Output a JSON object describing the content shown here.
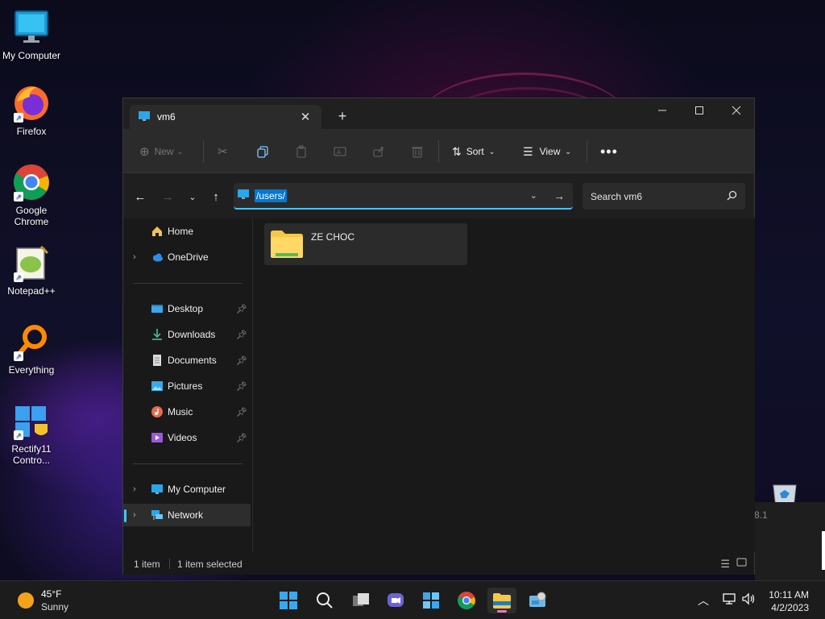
{
  "desktop": {
    "icons": [
      {
        "label": "My Computer",
        "icon": "monitor-icon"
      },
      {
        "label": "Firefox",
        "icon": "firefox-icon"
      },
      {
        "label": "Google Chrome",
        "icon": "chrome-icon"
      },
      {
        "label": "Notepad++",
        "icon": "notepadpp-icon"
      },
      {
        "label": "Everything",
        "icon": "everything-icon"
      },
      {
        "label": "Rectify11 Contro...",
        "icon": "rectify11-icon"
      }
    ],
    "partial_label": "8.1"
  },
  "window": {
    "tab_title": "vm6",
    "toolbar": {
      "new_label": "New",
      "sort_label": "Sort",
      "view_label": "View"
    },
    "address_path": "/users/",
    "search_placeholder": "Search vm6",
    "nav": {
      "home": "Home",
      "onedrive": "OneDrive",
      "quick_access": [
        {
          "label": "Desktop",
          "icon": "desktop-folder-icon"
        },
        {
          "label": "Downloads",
          "icon": "downloads-icon"
        },
        {
          "label": "Documents",
          "icon": "documents-icon"
        },
        {
          "label": "Pictures",
          "icon": "pictures-icon"
        },
        {
          "label": "Music",
          "icon": "music-icon"
        },
        {
          "label": "Videos",
          "icon": "videos-icon"
        }
      ],
      "my_computer": "My Computer",
      "network": "Network"
    },
    "items": [
      {
        "name": "ZE CHOC",
        "type": "folder"
      }
    ],
    "status": {
      "count": "1 item",
      "selected": "1 item selected"
    }
  },
  "taskbar": {
    "weather_temp": "45°F",
    "weather_desc": "Sunny",
    "time": "10:11 AM",
    "date": "4/2/2023"
  },
  "colors": {
    "accent": "#4cc2ff",
    "selection": "#0078d4",
    "folder": "#f6c945"
  }
}
